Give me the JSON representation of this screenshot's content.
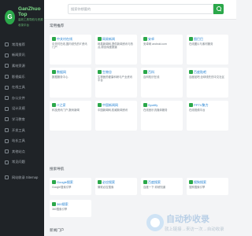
{
  "brand": {
    "mark": "G",
    "name": "GanZhuo Top",
    "tagline": "高效工具导航与资源收录平台"
  },
  "search": {
    "placeholder": "搜索你想要的"
  },
  "nav": [
    {
      "label": "常用推荐",
      "icon": "grid-icon"
    },
    {
      "label": "新闻资讯",
      "icon": "news-icon"
    },
    {
      "label": "素材资源",
      "icon": "image-icon"
    },
    {
      "label": "影视娱乐",
      "icon": "video-icon"
    },
    {
      "label": "在线工具",
      "icon": "tool-icon"
    },
    {
      "label": "办公文件",
      "icon": "file-icon"
    },
    {
      "label": "设计灵感",
      "icon": "palette-icon"
    },
    {
      "label": "学习教育",
      "icon": "book-icon"
    },
    {
      "label": "开发工具",
      "icon": "code-icon"
    },
    {
      "label": "站长工具",
      "icon": "chart-icon"
    },
    {
      "label": "其他站点",
      "icon": "globe-icon"
    },
    {
      "label": "常见问题",
      "icon": "question-icon"
    },
    {
      "label": "网站收录 Sitemap",
      "icon": "sitemap-icon"
    }
  ],
  "sections": {
    "recommended": "常用推荐",
    "search_nav": "搜索导航",
    "bottom": "新闻门户"
  },
  "cards": [
    {
      "title": "中关村在线",
      "desc": "中关村在线,国内领先的IT资讯门户"
    },
    {
      "title": "网易新闻",
      "desc": "网易新闻网,提供新闻资讯与热点,原创深度报道"
    },
    {
      "title": "安卓",
      "desc": "安卓网 android.com"
    },
    {
      "title": "图巴巴",
      "desc": "在线图片与素材服务"
    },
    {
      "title": "数据网",
      "desc": "数据服务中心"
    },
    {
      "title": "生物谷",
      "desc": "生物医药健康科研与产业资讯平台"
    },
    {
      "title": "百科",
      "desc": "百科知识在线"
    },
    {
      "title": "百度贴吧",
      "desc": "百度贴吧,全球领先的中文社区"
    },
    {
      "title": "IT之家",
      "desc": "科技资讯门户,数码新闻"
    },
    {
      "title": "中国新闻网",
      "desc": "中国新闻网,权威新闻资讯"
    },
    {
      "title": "Spotify",
      "desc": "在线音乐流媒体服务"
    },
    {
      "title": "PPTV聚力",
      "desc": "在线视频平台"
    }
  ],
  "search_cards": [
    {
      "title": "Google搜索",
      "desc": "Google搜索引擎"
    },
    {
      "title": "必应搜索",
      "desc": "微软必应搜索"
    },
    {
      "title": "百度搜索",
      "desc": "百度一下,你就知道"
    },
    {
      "title": "搜狗搜索",
      "desc": "搜狗搜索引擎"
    },
    {
      "title": "360搜索",
      "desc": "360搜索引擎"
    }
  ],
  "watermark": {
    "title": "自动秒收录",
    "subtitle": "就上链接→来访一次→自动收录"
  }
}
